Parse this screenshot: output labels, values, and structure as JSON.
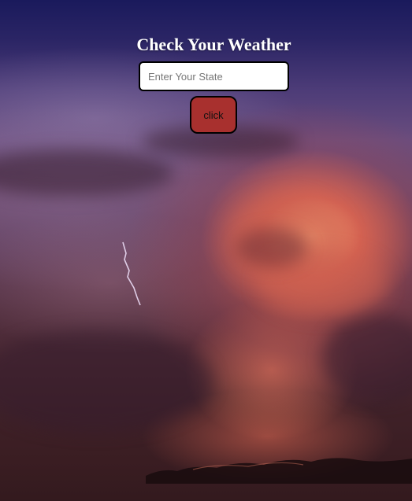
{
  "header": {
    "title": "Check Your Weather"
  },
  "search": {
    "placeholder": "Enter Your State",
    "value": ""
  },
  "actions": {
    "submit_label": "click"
  },
  "colors": {
    "button_bg": "#a8302e",
    "title_text": "#ffffff",
    "input_bg": "#ffffff"
  },
  "background": {
    "scene": "storm-clouds-lightning-over-water"
  }
}
